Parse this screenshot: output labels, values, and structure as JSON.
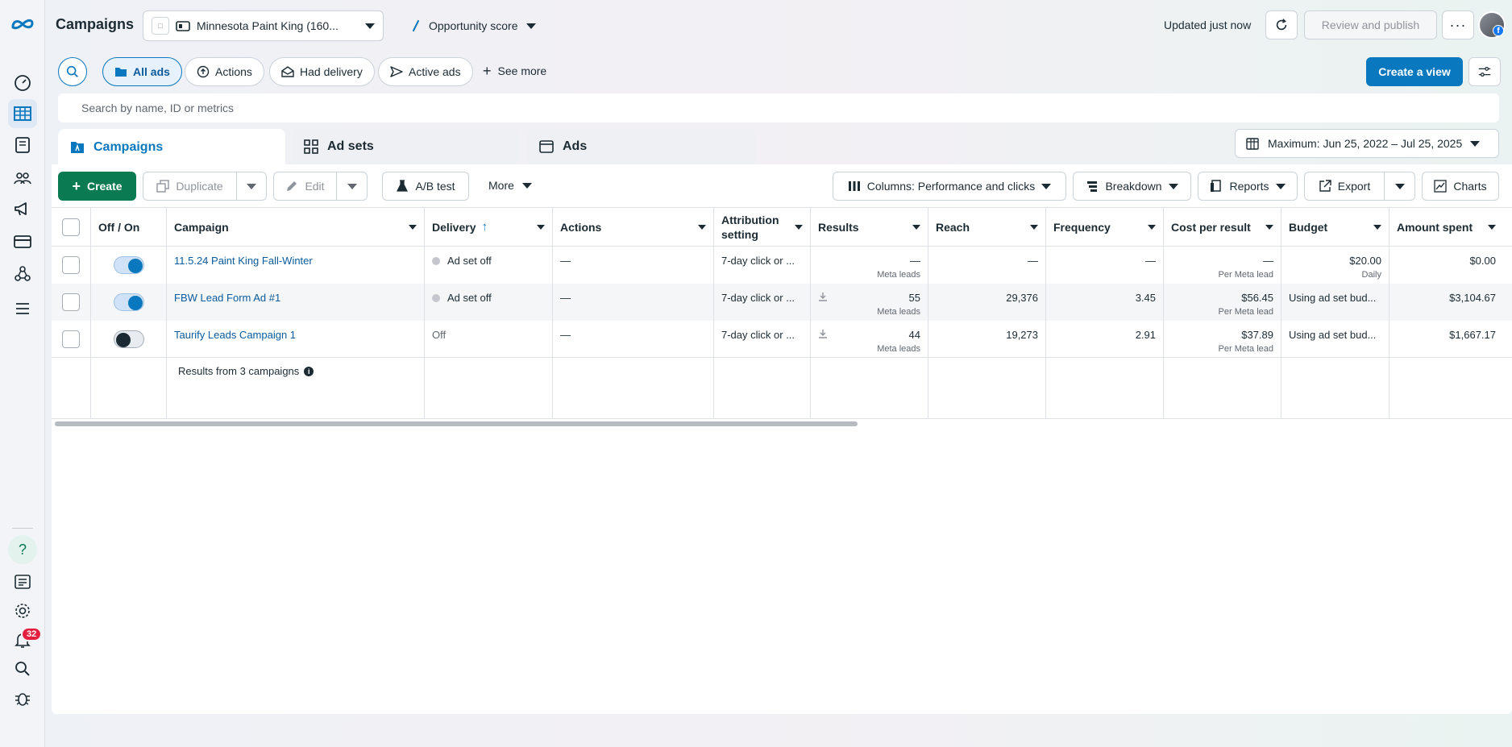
{
  "header": {
    "title": "Campaigns",
    "account_name": "Minnesota Paint King (160...",
    "opportunity_label": "Opportunity score",
    "updated_text": "Updated just now",
    "review_publish_label": "Review and publish",
    "more_label": "···"
  },
  "filters": {
    "all_ads": "All ads",
    "actions": "Actions",
    "had_delivery": "Had delivery",
    "active_ads": "Active ads",
    "see_more": "See more",
    "create_view": "Create a view"
  },
  "search": {
    "placeholder": "Search by name, ID or metrics"
  },
  "tabs": {
    "campaigns": "Campaigns",
    "ad_sets": "Ad sets",
    "ads": "Ads"
  },
  "date_range": "Maximum: Jun 25, 2022 – Jul 25, 2025",
  "toolbar": {
    "create": "Create",
    "duplicate": "Duplicate",
    "edit": "Edit",
    "ab_test": "A/B test",
    "more": "More",
    "columns": "Columns: Performance and clicks",
    "breakdown": "Breakdown",
    "reports": "Reports",
    "export": "Export",
    "charts": "Charts"
  },
  "table": {
    "headers": {
      "off_on": "Off / On",
      "campaign": "Campaign",
      "delivery": "Delivery",
      "actions": "Actions",
      "attribution": "Attribution setting",
      "results": "Results",
      "reach": "Reach",
      "frequency": "Frequency",
      "cost_per_result": "Cost per result",
      "budget": "Budget",
      "amount_spent": "Amount spent"
    },
    "rows": [
      {
        "name": "11.5.24 Paint King Fall-Winter",
        "delivery": "Ad set off",
        "actions": "—",
        "attribution": "7-day click or ...",
        "results": "—",
        "results_sub": "Meta leads",
        "reach": "—",
        "frequency": "—",
        "cpr": "—",
        "cpr_sub": "Per Meta lead",
        "budget": "$20.00",
        "budget_sub": "Daily",
        "spent": "$0.00"
      },
      {
        "name": "FBW Lead Form Ad #1",
        "delivery": "Ad set off",
        "actions": "—",
        "attribution": "7-day click or ...",
        "results": "55",
        "results_sub": "Meta leads",
        "reach": "29,376",
        "frequency": "3.45",
        "cpr": "$56.45",
        "cpr_sub": "Per Meta lead",
        "budget": "Using ad set bud...",
        "budget_sub": "",
        "spent": "$3,104.67"
      },
      {
        "name": "Taurify Leads Campaign 1",
        "delivery": "Off",
        "actions": "—",
        "attribution": "7-day click or ...",
        "results": "44",
        "results_sub": "Meta leads",
        "reach": "19,273",
        "frequency": "2.91",
        "cpr": "$37.89",
        "cpr_sub": "Per Meta lead",
        "budget": "Using ad set bud...",
        "budget_sub": "",
        "spent": "$1,667.17"
      }
    ],
    "summary": "Results from 3 campaigns"
  },
  "nav": {
    "notification_count": "32",
    "help": "?"
  },
  "colors": {
    "primary": "#0a78be",
    "create_green": "#0a7a52",
    "badge_red": "#e41e3f"
  }
}
